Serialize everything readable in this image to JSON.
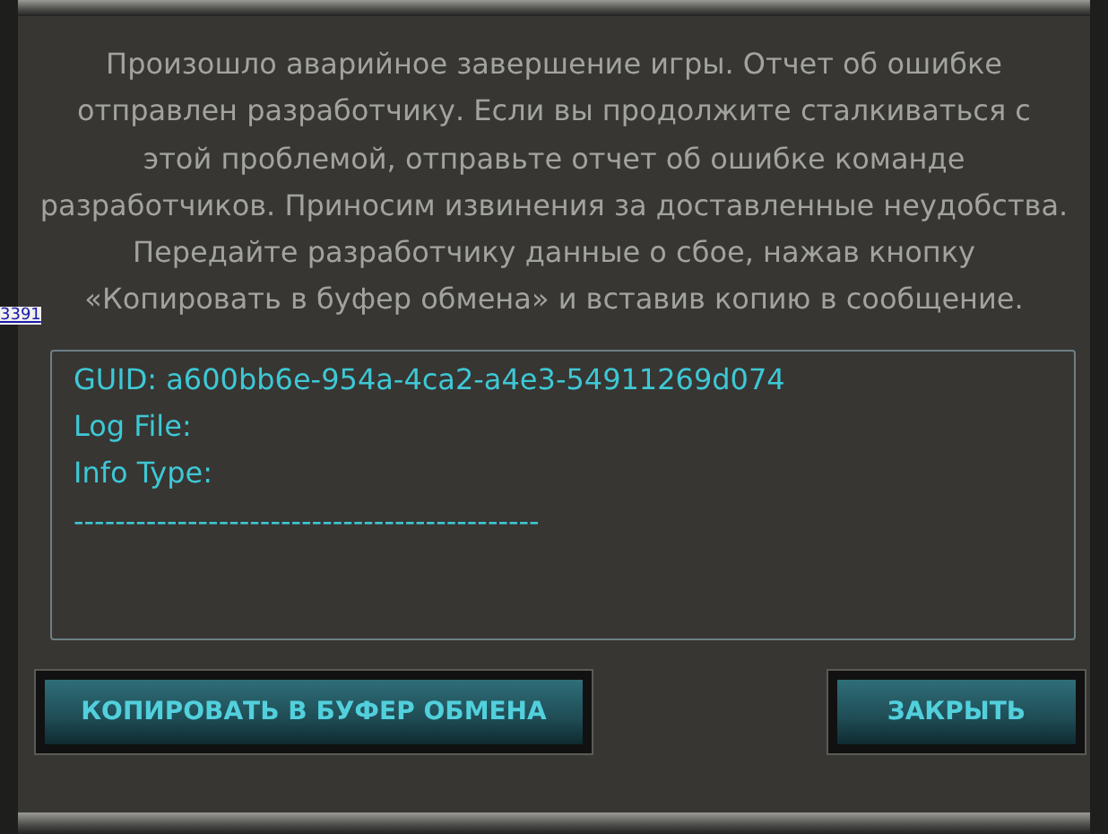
{
  "message": "Произошло аварийное завершение игры. Отчет об ошибке отправлен разработчику. Если вы продолжите сталкиваться с этой проблемой, отправьте отчет об ошибке команде разработчиков. Приносим извинения за доставленные неудобства. Передайте разработчику данные о сбое, нажав кнопку «Копировать в буфер обмена» и вставив копию в сообщение.",
  "log_lines": [
    "GUID: a600bb6e-954a-4ca2-a4e3-54911269d074",
    "Log File:",
    "Info Type:",
    "---------------------------------------------"
  ],
  "side_link": "3391",
  "buttons": [
    {
      "label": "КОПИРОВАТЬ В БУФЕР ОБМЕНА"
    },
    {
      "label": "ЗАКРЫТЬ"
    }
  ]
}
